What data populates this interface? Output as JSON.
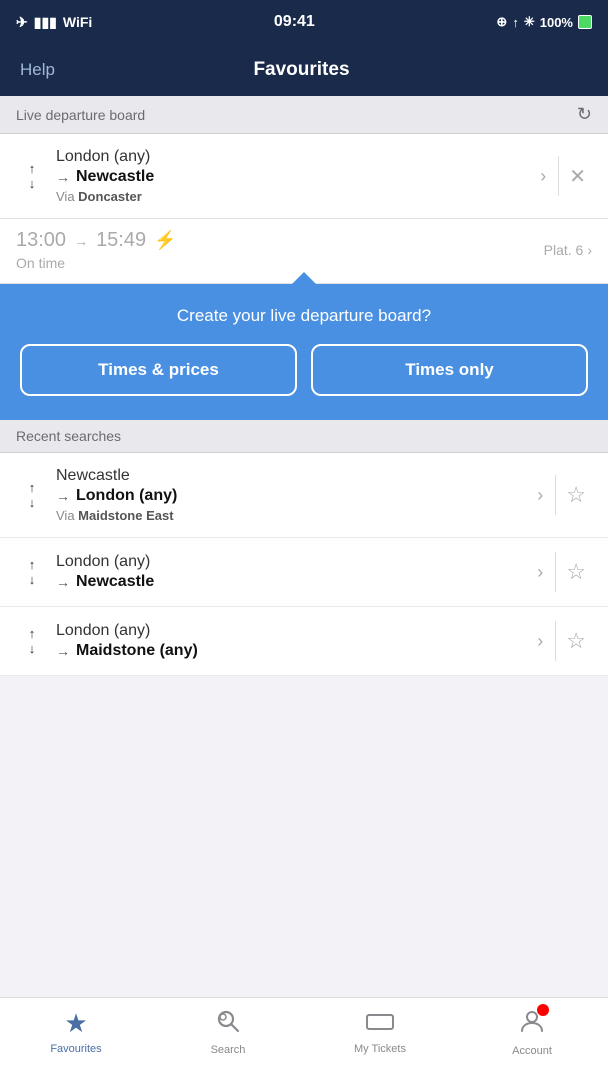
{
  "statusBar": {
    "time": "09:41",
    "battery": "100%"
  },
  "nav": {
    "helpLabel": "Help",
    "title": "Favourites"
  },
  "liveBoard": {
    "sectionTitle": "Live departure board",
    "favourite": {
      "from": "London (any)",
      "to": "Newcastle",
      "via": "Doncaster",
      "depTime": "13:00",
      "arrTime": "15:49",
      "onTime": "On time",
      "platform": "Plat. 6"
    }
  },
  "popup": {
    "title": "Create your live departure board?",
    "btn1": "Times & prices",
    "btn2": "Times only"
  },
  "recentSearches": {
    "sectionTitle": "Recent searches",
    "items": [
      {
        "from": "Newcastle",
        "to": "London (any)",
        "via": "Maidstone East"
      },
      {
        "from": "London (any)",
        "to": "Newcastle",
        "via": ""
      },
      {
        "from": "London (any)",
        "to": "Maidstone (any)",
        "via": ""
      }
    ]
  },
  "tabBar": {
    "tabs": [
      {
        "label": "Favourites",
        "icon": "★",
        "active": true
      },
      {
        "label": "Search",
        "icon": "🔍",
        "active": false
      },
      {
        "label": "My Tickets",
        "icon": "▭",
        "active": false
      },
      {
        "label": "Account",
        "icon": "👤",
        "active": false,
        "badge": true
      }
    ]
  }
}
